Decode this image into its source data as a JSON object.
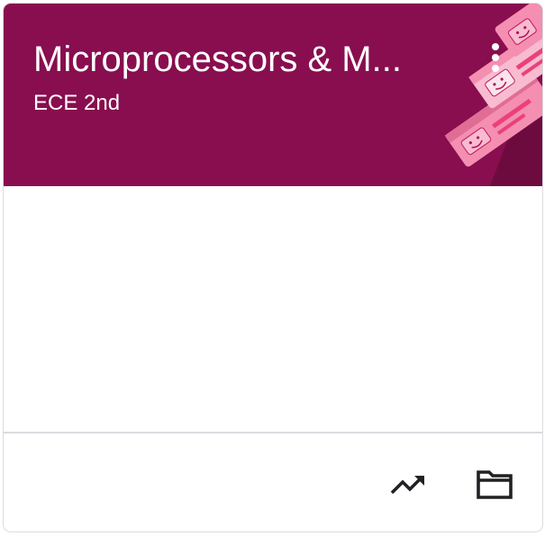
{
  "colors": {
    "header_bg": "#880e4f",
    "header_text": "#ffffff",
    "icon": "#202124",
    "divider": "#dadce0"
  },
  "course_card": {
    "title": "Microprocessors & M...",
    "section": "ECE 2nd",
    "menu_icon": "more-vert-icon",
    "footer_actions": [
      {
        "icon": "trending-up-icon"
      },
      {
        "icon": "folder-icon"
      }
    ]
  }
}
